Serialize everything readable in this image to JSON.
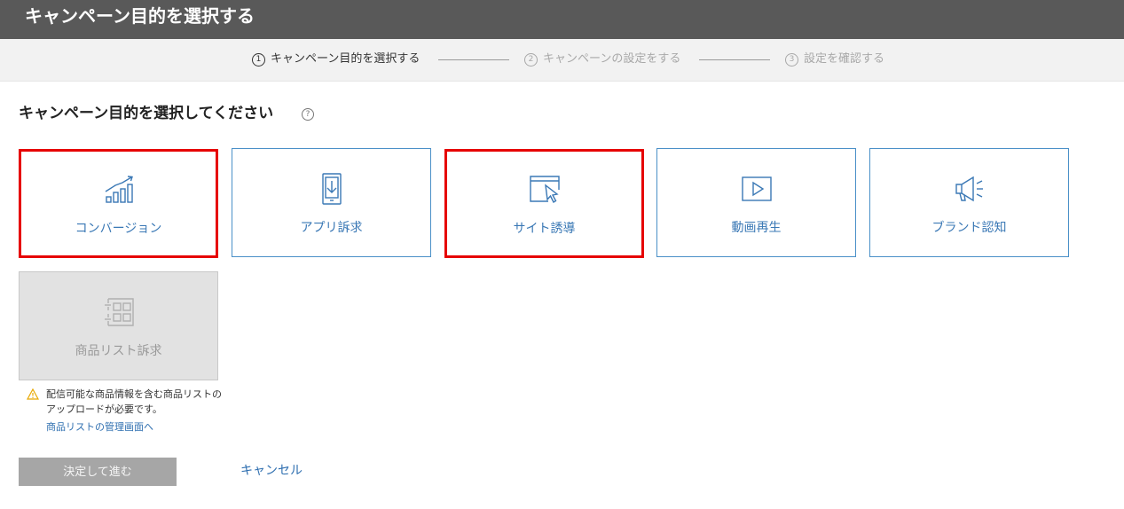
{
  "header": {
    "title": "キャンペーン目的を選択する"
  },
  "steps": [
    {
      "number": "1",
      "label": "キャンペーン目的を選択する",
      "state": "active"
    },
    {
      "number": "2",
      "label": "キャンペーンの設定をする",
      "state": "inactive"
    },
    {
      "number": "3",
      "label": "設定を確認する",
      "state": "inactive"
    }
  ],
  "section": {
    "title": "キャンペーン目的を選択してください",
    "help_icon": "help-circle-icon",
    "help_glyph": "?"
  },
  "objectives": [
    {
      "label": "コンバージョン",
      "icon": "bar-chart-growth-icon",
      "highlighted": true,
      "disabled": false
    },
    {
      "label": "アプリ訴求",
      "icon": "mobile-download-icon",
      "highlighted": false,
      "disabled": false
    },
    {
      "label": "サイト誘導",
      "icon": "browser-cursor-icon",
      "highlighted": true,
      "disabled": false
    },
    {
      "label": "動画再生",
      "icon": "video-play-icon",
      "highlighted": false,
      "disabled": false
    },
    {
      "label": "ブランド認知",
      "icon": "megaphone-icon",
      "highlighted": false,
      "disabled": false
    },
    {
      "label": "商品リスト訴求",
      "icon": "product-grid-icon",
      "highlighted": false,
      "disabled": true
    }
  ],
  "notice": {
    "icon": "warning-triangle-icon",
    "text": "配信可能な商品情報を含む商品リストのアップロードが必要です。",
    "link": "商品リストの管理画面へ"
  },
  "actions": {
    "next_label": "決定して進む",
    "cancel_label": "キャンセル"
  },
  "colors": {
    "header_bg": "#595959",
    "accent_blue": "#3a78b5",
    "card_border": "#4a90c8",
    "highlight_red": "#e60000",
    "disabled_bg": "#e2e2e2",
    "button_disabled": "#a6a6a6",
    "warning_yellow": "#e8a800"
  }
}
